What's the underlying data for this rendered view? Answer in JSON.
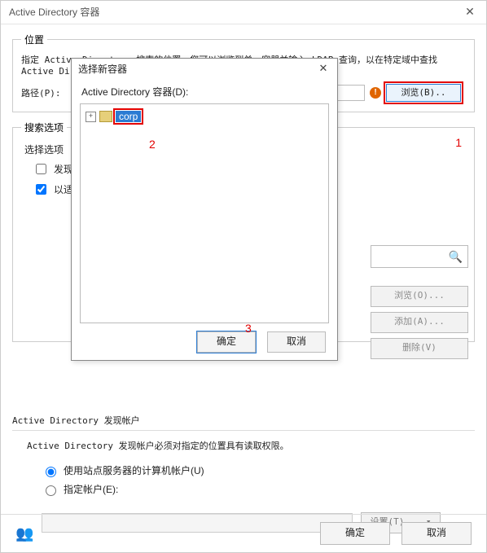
{
  "window": {
    "title": "Active Directory 容器",
    "close_glyph": "✕"
  },
  "location": {
    "legend": "位置",
    "description": "指定 Active Directory 搜索的位置。您可以浏览到单一容器并输入 LDAP 查询，以在特定域中查找 Active Directory                                                                            Directory 容器。",
    "path_label": "路径(P):",
    "path_value": "",
    "browse_label": "浏览(B)..",
    "warn_glyph": "!"
  },
  "search": {
    "legend": "搜索选项",
    "options_label": "选择选项",
    "opt_discover": "发现",
    "opt_by": "以适",
    "opt_discover_checked": false,
    "opt_by_checked": true
  },
  "sidebar": {
    "search_icon_glyph": "🔍",
    "browse_btn": "浏览(O)...",
    "add_btn": "添加(A)...",
    "delete_btn": "删除(V)"
  },
  "discover": {
    "header": "Active Directory 发现帐户",
    "note": "Active Directory 发现帐户必须对指定的位置具有读取权限。",
    "radio_site": "使用站点服务器的计算机帐户(U)",
    "radio_specify": "指定帐户(E):",
    "selected": "site",
    "account_value": "",
    "set_btn": "设置(T)... ▾"
  },
  "footer": {
    "help_glyph": "👥",
    "ok": "确定",
    "cancel": "取消"
  },
  "modal": {
    "title": "选择新容器",
    "close_glyph": "✕",
    "label": "Active Directory 容器(D):",
    "tree": {
      "expand_glyph": "+",
      "node": "corp"
    },
    "ok": "确定",
    "cancel": "取消"
  },
  "annotations": {
    "a1": "1",
    "a2": "2",
    "a3": "3"
  }
}
